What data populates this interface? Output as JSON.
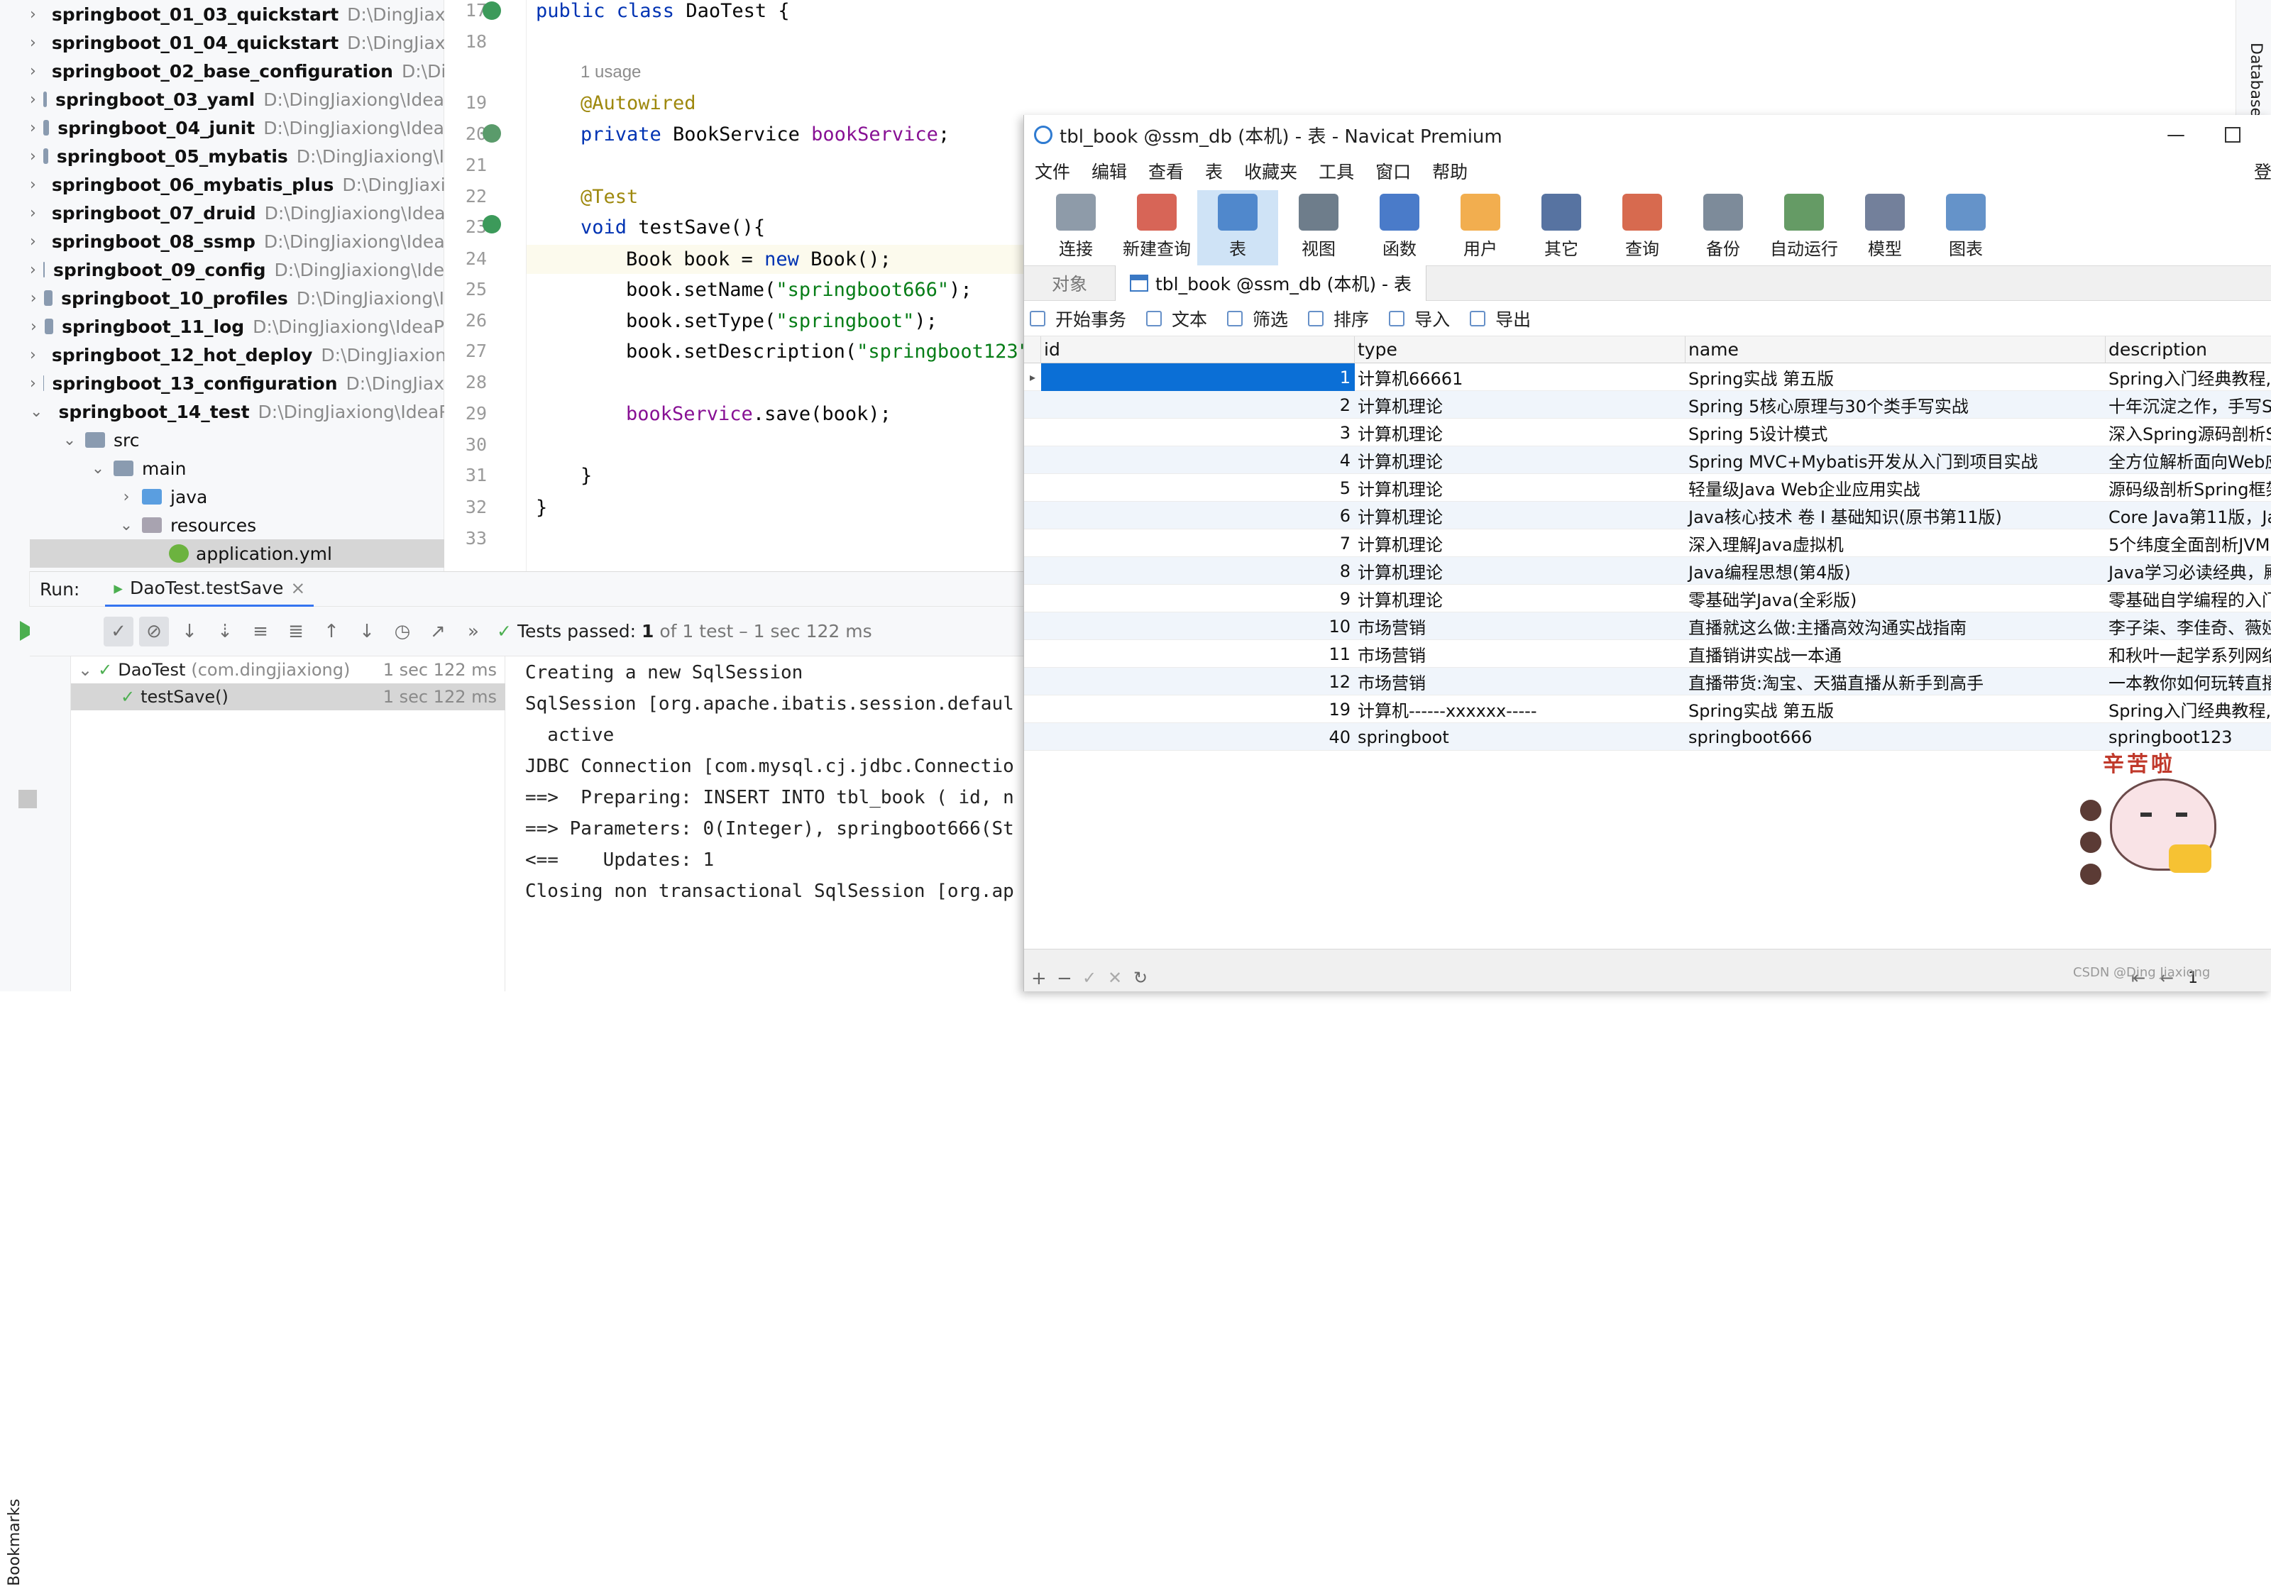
{
  "project_tree": {
    "items": [
      {
        "name": "springboot_01_03_quickstart",
        "path": "D:\\DingJiaxi"
      },
      {
        "name": "springboot_01_04_quickstart",
        "path": "D:\\DingJiaxi"
      },
      {
        "name": "springboot_02_base_configuration",
        "path": "D:\\Di"
      },
      {
        "name": "springboot_03_yaml",
        "path": "D:\\DingJiaxiong\\Idea"
      },
      {
        "name": "springboot_04_junit",
        "path": "D:\\DingJiaxiong\\Idea"
      },
      {
        "name": "springboot_05_mybatis",
        "path": "D:\\DingJiaxiong\\I"
      },
      {
        "name": "springboot_06_mybatis_plus",
        "path": "D:\\DingJiaxi"
      },
      {
        "name": "springboot_07_druid",
        "path": "D:\\DingJiaxiong\\Idea"
      },
      {
        "name": "springboot_08_ssmp",
        "path": "D:\\DingJiaxiong\\Idea"
      },
      {
        "name": "springboot_09_config",
        "path": "D:\\DingJiaxiong\\Ide"
      },
      {
        "name": "springboot_10_profiles",
        "path": "D:\\DingJiaxiong\\I"
      },
      {
        "name": "springboot_11_log",
        "path": "D:\\DingJiaxiong\\IdeaP"
      },
      {
        "name": "springboot_12_hot_deploy",
        "path": "D:\\DingJiaxion"
      },
      {
        "name": "springboot_13_configuration",
        "path": "D:\\DingJiax"
      },
      {
        "name": "springboot_14_test",
        "path": "D:\\DingJiaxiong\\IdeaP"
      }
    ],
    "src": "src",
    "main": "main",
    "java": "java",
    "resources": "resources",
    "app_yml": "application.yml"
  },
  "editor": {
    "line_numbers": [
      "17",
      "18",
      "19",
      "20",
      "21",
      "22",
      "23",
      "24",
      "25",
      "26",
      "27",
      "28",
      "29",
      "30",
      "31",
      "32",
      "33"
    ],
    "usage_hint": "1 usage",
    "lines": {
      "l17a": "public class ",
      "l17b": "DaoTest {",
      "l19": "@Autowired",
      "l20a": "private ",
      "l20b": "BookService ",
      "l20c": "bookService",
      "l20d": ";",
      "l22": "@Test",
      "l23a": "void ",
      "l23b": "testSave(){",
      "l24a": "Book book = ",
      "l24b": "new ",
      "l24c": "Book();",
      "l25a": "book.setName(",
      "l25b": "\"springboot666\"",
      "l25c": ");",
      "l26a": "book.setType(",
      "l26b": "\"springboot\"",
      "l26c": ");",
      "l27a": "book.setDescription(",
      "l27b": "\"springboot123\"",
      "l29a": "bookService",
      "l29b": ".save(book);",
      "l31": "}",
      "l32": "}"
    }
  },
  "run_panel": {
    "label": "Run:",
    "tab": "DaoTest.testSave",
    "status_prefix": "Tests passed: ",
    "status_count": "1",
    "status_rest": " of 1 test – 1 sec 122 ms",
    "tests": [
      {
        "name": "DaoTest",
        "pkg": "(com.dingjiaxiong)",
        "time": "1 sec 122 ms"
      },
      {
        "name": "testSave()",
        "pkg": "",
        "time": "1 sec 122 ms"
      }
    ],
    "console": [
      "Creating a new SqlSession",
      "SqlSession [org.apache.ibatis.session.defaul",
      "  active",
      "JDBC Connection [com.mysql.cj.jdbc.Connectio",
      "==>  Preparing: INSERT INTO tbl_book ( id, n",
      "==> Parameters: 0(Integer), springboot666(St",
      "<==    Updates: 1",
      "Closing non transactional SqlSession [org.ap"
    ],
    "bookmarks": "Bookmarks"
  },
  "navicat": {
    "title": "tbl_book @ssm_db (本机) - 表 - Navicat Premium",
    "menu": [
      "文件",
      "编辑",
      "查看",
      "表",
      "收藏夹",
      "工具",
      "窗口",
      "帮助"
    ],
    "menu_right": "登",
    "toolbar": [
      "连接",
      "新建查询",
      "表",
      "视图",
      "函数",
      "用户",
      "其它",
      "查询",
      "备份",
      "自动运行",
      "模型",
      "图表"
    ],
    "tabs": [
      "对象",
      "tbl_book @ssm_db (本机) - 表"
    ],
    "subtoolbar": [
      "开始事务",
      "文本",
      "筛选",
      "排序",
      "导入",
      "导出"
    ],
    "columns": [
      "id",
      "type",
      "name",
      "description"
    ],
    "rows": [
      {
        "id": "1",
        "type": "计算机66661",
        "name": "Spring实战 第五版",
        "description": "Spring入门经典教程,"
      },
      {
        "id": "2",
        "type": "计算机理论",
        "name": "Spring 5核心原理与30个类手写实战",
        "description": "十年沉淀之作，手写S"
      },
      {
        "id": "3",
        "type": "计算机理论",
        "name": "Spring 5设计模式",
        "description": "深入Spring源码剖析S"
      },
      {
        "id": "4",
        "type": "计算机理论",
        "name": "Spring MVC+Mybatis开发从入门到项目实战",
        "description": "全方位解析面向Web应"
      },
      {
        "id": "5",
        "type": "计算机理论",
        "name": "轻量级Java Web企业应用实战",
        "description": "源码级剖析Spring框架"
      },
      {
        "id": "6",
        "type": "计算机理论",
        "name": "Java核心技术 卷 I 基础知识(原书第11版)",
        "description": "Core Java第11版，Jav"
      },
      {
        "id": "7",
        "type": "计算机理论",
        "name": "深入理解Java虚拟机",
        "description": "5个纬度全面剖析JVM"
      },
      {
        "id": "8",
        "type": "计算机理论",
        "name": "Java编程思想(第4版)",
        "description": "Java学习必读经典，殿"
      },
      {
        "id": "9",
        "type": "计算机理论",
        "name": "零基础学Java(全彩版)",
        "description": "零基础自学编程的入门"
      },
      {
        "id": "10",
        "type": "市场营销",
        "name": "直播就这么做:主播高效沟通实战指南",
        "description": "李子柒、李佳奇、薇娅"
      },
      {
        "id": "11",
        "type": "市场营销",
        "name": "直播销讲实战一本通",
        "description": "和秋叶一起学系列网络"
      },
      {
        "id": "12",
        "type": "市场营销",
        "name": "直播带货:淘宝、天猫直播从新手到高手",
        "description": "一本教你如何玩转直播"
      },
      {
        "id": "19",
        "type": "计算机------xxxxxx-----",
        "name": "Spring实战 第五版",
        "description": "Spring入门经典教程,"
      },
      {
        "id": "40",
        "type": "springboot",
        "name": "springboot666",
        "description": "springboot123"
      }
    ],
    "sticker_text": "辛苦啦",
    "watermark": "CSDN @Ding Jiaxiong",
    "page": "1"
  },
  "right_sidebar": "Database"
}
